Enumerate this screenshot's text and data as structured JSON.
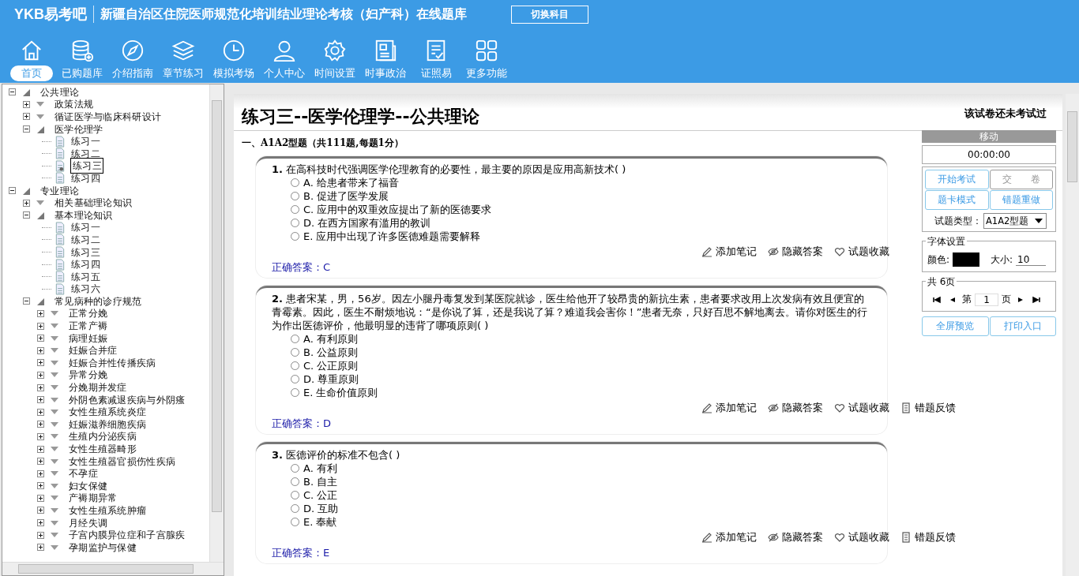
{
  "header": {
    "logo": "YKB易考吧",
    "title": "新疆自治区住院医师规范化培训结业理论考核（妇产科）在线题库",
    "switch_button": "切换科目"
  },
  "nav": [
    {
      "label": "首页",
      "selected": true
    },
    {
      "label": "已购题库",
      "selected": false
    },
    {
      "label": "介绍指南",
      "selected": false
    },
    {
      "label": "章节练习",
      "selected": false
    },
    {
      "label": "模拟考场",
      "selected": false
    },
    {
      "label": "个人中心",
      "selected": false
    },
    {
      "label": "时间设置",
      "selected": false
    },
    {
      "label": "时事政治",
      "selected": false
    },
    {
      "label": "证照易",
      "selected": false
    },
    {
      "label": "更多功能",
      "selected": false
    }
  ],
  "tree": [
    {
      "label": "公共理论",
      "kind": "folder",
      "expanded": true,
      "children": [
        {
          "label": "政策法规",
          "kind": "folder",
          "expanded": false
        },
        {
          "label": "循证医学与临床科研设计",
          "kind": "folder",
          "expanded": false
        },
        {
          "label": "医学伦理学",
          "kind": "folder",
          "expanded": true,
          "children": [
            {
              "label": "练习一",
              "kind": "leaf",
              "selected": false
            },
            {
              "label": "练习二",
              "kind": "leaf",
              "selected": false
            },
            {
              "label": "练习三",
              "kind": "leaf",
              "selected": true
            },
            {
              "label": "练习四",
              "kind": "leaf",
              "selected": false
            }
          ]
        }
      ]
    },
    {
      "label": "专业理论",
      "kind": "folder",
      "expanded": true,
      "children": [
        {
          "label": "相关基础理论知识",
          "kind": "folder",
          "expanded": false
        },
        {
          "label": "基本理论知识",
          "kind": "folder",
          "expanded": true,
          "children": [
            {
              "label": "练习一",
              "kind": "leaf",
              "selected": false
            },
            {
              "label": "练习二",
              "kind": "leaf",
              "selected": false
            },
            {
              "label": "练习三",
              "kind": "leaf",
              "selected": false
            },
            {
              "label": "练习四",
              "kind": "leaf",
              "selected": false
            },
            {
              "label": "练习五",
              "kind": "leaf",
              "selected": false
            },
            {
              "label": "练习六",
              "kind": "leaf",
              "selected": false
            }
          ]
        },
        {
          "label": "常见病种的诊疗规范",
          "kind": "folder",
          "expanded": true,
          "children": [
            {
              "label": "正常分娩",
              "kind": "folder",
              "expanded": false
            },
            {
              "label": "正常产褥",
              "kind": "folder",
              "expanded": false
            },
            {
              "label": "病理妊娠",
              "kind": "folder",
              "expanded": false
            },
            {
              "label": "妊娠合并症",
              "kind": "folder",
              "expanded": false
            },
            {
              "label": "妊娠合并性传播疾病",
              "kind": "folder",
              "expanded": false
            },
            {
              "label": "异常分娩",
              "kind": "folder",
              "expanded": false
            },
            {
              "label": "分娩期并发症",
              "kind": "folder",
              "expanded": false
            },
            {
              "label": "外阴色素减退疾病与外阴瘙",
              "kind": "folder",
              "expanded": false
            },
            {
              "label": "女性生殖系统炎症",
              "kind": "folder",
              "expanded": false
            },
            {
              "label": "妊娠滋养细胞疾病",
              "kind": "folder",
              "expanded": false
            },
            {
              "label": "生殖内分泌疾病",
              "kind": "folder",
              "expanded": false
            },
            {
              "label": "女性生殖器畸形",
              "kind": "folder",
              "expanded": false
            },
            {
              "label": "女性生殖器官损伤性疾病",
              "kind": "folder",
              "expanded": false
            },
            {
              "label": "不孕症",
              "kind": "folder",
              "expanded": false
            },
            {
              "label": "妇女保健",
              "kind": "folder",
              "expanded": false
            },
            {
              "label": "产褥期异常",
              "kind": "folder",
              "expanded": false
            },
            {
              "label": "女性生殖系统肿瘤",
              "kind": "folder",
              "expanded": false
            },
            {
              "label": "月经失调",
              "kind": "folder",
              "expanded": false
            },
            {
              "label": "子宫内膜异位症和子宫腺疾",
              "kind": "folder",
              "expanded": false
            },
            {
              "label": "孕期监护与保健",
              "kind": "folder",
              "expanded": false
            }
          ]
        }
      ]
    }
  ],
  "paper": {
    "title": "练习三--医学伦理学--公共理论",
    "status": "该试卷还未考试过",
    "section": "一、A1A2型题（共111题,每题1分）"
  },
  "questions": [
    {
      "number": "1.",
      "text": "在高科技时代强调医学伦理教育的必要性，最主要的原因是应用高新技术( )",
      "options": [
        {
          "label": "A. 给患者带来了福音",
          "selected": false
        },
        {
          "label": "B. 促进了医学发展",
          "selected": false
        },
        {
          "label": "C. 应用中的双重效应提出了新的医德要求",
          "selected": false
        },
        {
          "label": "D. 在西方国家有滥用的教训",
          "selected": false
        },
        {
          "label": "E. 应用中出现了许多医德难题需要解释",
          "selected": false
        }
      ],
      "actions": [
        "添加笔记",
        "隐藏答案",
        "试题收藏"
      ],
      "answer": "正确答案：C"
    },
    {
      "number": "2.",
      "text": "患者宋某，男，56岁。因左小腿丹毒复发到某医院就诊，医生给他开了较昂贵的新抗生素，患者要求改用上次发病有效且便宜的青霉素。因此，医生不耐烦地说：“是你说了算，还是我说了算？难道我会害你！”患者无奈，只好百思不解地离去。请你对医生的行为作出医德评价，他最明显的违背了哪项原则( )",
      "options": [
        {
          "label": "A. 有利原则",
          "selected": false
        },
        {
          "label": "B. 公益原则",
          "selected": false
        },
        {
          "label": "C. 公正原则",
          "selected": false
        },
        {
          "label": "D. 尊重原则",
          "selected": false
        },
        {
          "label": "E. 生命价值原则",
          "selected": false
        }
      ],
      "actions": [
        "添加笔记",
        "隐藏答案",
        "试题收藏",
        "错题反馈"
      ],
      "answer": "正确答案：D"
    },
    {
      "number": "3.",
      "text": "医德评价的标准不包含( )",
      "options": [
        {
          "label": "A. 有利",
          "selected": false
        },
        {
          "label": "B. 自主",
          "selected": false
        },
        {
          "label": "C. 公正",
          "selected": false
        },
        {
          "label": "D. 互助",
          "selected": false
        },
        {
          "label": "E. 奉献",
          "selected": false
        }
      ],
      "actions": [
        "添加笔记",
        "隐藏答案",
        "试题收藏",
        "错题反馈"
      ],
      "answer": "正确答案：E"
    }
  ],
  "panel": {
    "header": "移动",
    "timer": "00:00:00",
    "buttons": [
      {
        "label": "开始考试",
        "disabled": false
      },
      {
        "label": "交　　卷",
        "disabled": true
      },
      {
        "label": "题卡模式",
        "disabled": false
      },
      {
        "label": "错题重做",
        "disabled": false
      }
    ],
    "type_label": "试题类型：",
    "type_value": "A1A2型题",
    "font_settings": {
      "legend": "字体设置",
      "color_label": "颜色:",
      "color": "#000000",
      "size_label": "大小:",
      "size": "10"
    },
    "pager": {
      "legend": "共 6页",
      "prefix": "第",
      "page": "1",
      "suffix": "页"
    },
    "bottom_buttons": [
      "全屏预览",
      "打印入口"
    ]
  }
}
